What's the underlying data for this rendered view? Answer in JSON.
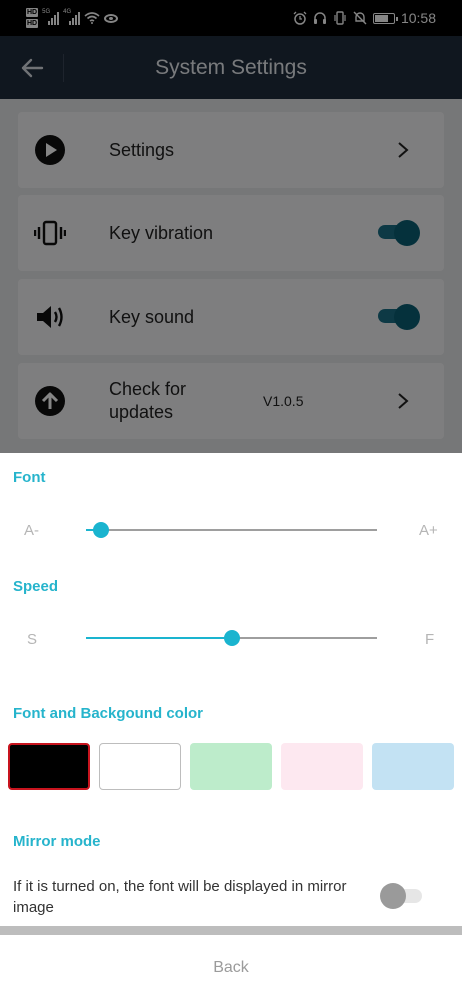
{
  "status_bar": {
    "hd1": "HD",
    "hd2": "HD",
    "net1": "5G",
    "net2": "4G",
    "time": "10:58"
  },
  "header": {
    "title": "System Settings"
  },
  "settings": {
    "items": [
      {
        "label": "Settings",
        "icon": "play-circle-icon",
        "control": "chevron"
      },
      {
        "label": "Key vibration",
        "icon": "vibration-icon",
        "control": "toggle",
        "on": true
      },
      {
        "label": "Key sound",
        "icon": "speaker-icon",
        "control": "toggle",
        "on": true
      },
      {
        "label": "Check for updates",
        "icon": "upload-circle-icon",
        "control": "chevron",
        "version": "V1.0.5"
      }
    ]
  },
  "sheet": {
    "font": {
      "title": "Font",
      "min_label": "A-",
      "max_label": "A+",
      "value": 0.05
    },
    "speed": {
      "title": "Speed",
      "min_label": "S",
      "max_label": "F",
      "value": 0.5
    },
    "color": {
      "title": "Font and Backgound color",
      "swatches": [
        "#000000",
        "#ffffff",
        "#bdeccb",
        "#fde8f0",
        "#c3e2f3"
      ],
      "selected_index": 0,
      "selected_border": "#c8141e"
    },
    "mirror": {
      "title": "Mirror mode",
      "description": "If it is turned on, the font will be displayed in mirror image",
      "on": false
    },
    "back_label": "Back"
  },
  "colors": {
    "accent": "#1ab4cf",
    "header_bg": "#202c3d"
  }
}
